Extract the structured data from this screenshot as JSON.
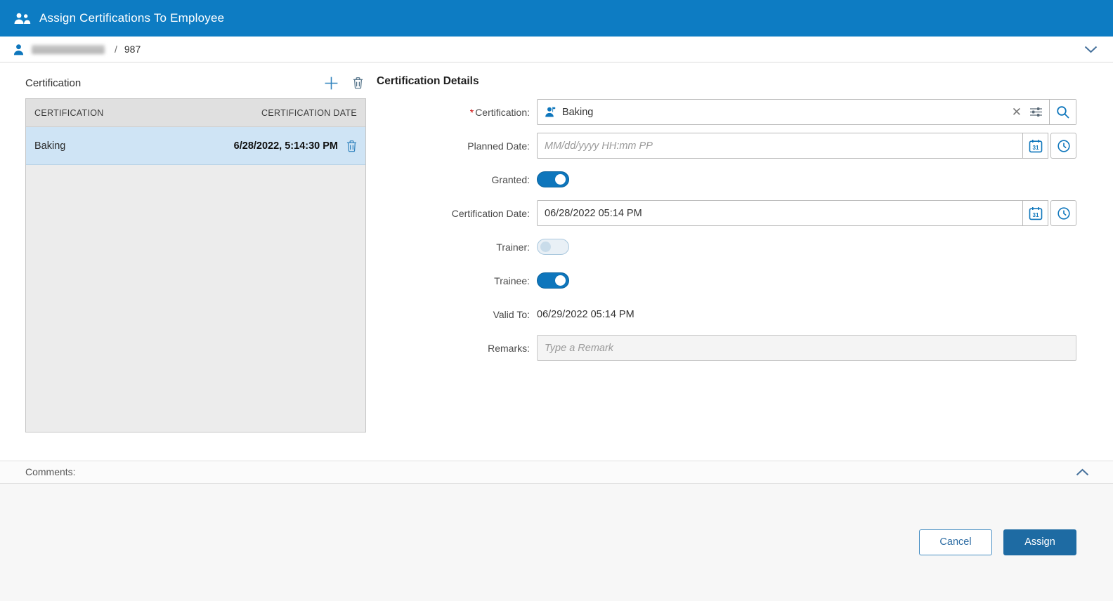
{
  "header": {
    "title": "Assign Certifications To Employee"
  },
  "employee_bar": {
    "separator": "/",
    "employee_id": "987"
  },
  "left_panel": {
    "title": "Certification",
    "table": {
      "columns": [
        "CERTIFICATION",
        "CERTIFICATION DATE"
      ],
      "rows": [
        {
          "certification": "Baking",
          "certification_date": "6/28/2022, 5:14:30 PM"
        }
      ]
    }
  },
  "details": {
    "title": "Certification Details",
    "certification": {
      "required_mark": "*",
      "label": "Certification:",
      "value": "Baking"
    },
    "planned_date": {
      "label": "Planned Date:",
      "placeholder": "MM/dd/yyyy HH:mm PP",
      "value": ""
    },
    "granted": {
      "label": "Granted:",
      "state": "on"
    },
    "certification_date": {
      "label": "Certification Date:",
      "value": "06/28/2022 05:14 PM"
    },
    "trainer": {
      "label": "Trainer:",
      "state": "off"
    },
    "trainee": {
      "label": "Trainee:",
      "state": "on"
    },
    "valid_to": {
      "label": "Valid To:",
      "value": "06/29/2022 05:14 PM"
    },
    "remarks": {
      "label": "Remarks:",
      "placeholder": "Type a Remark",
      "value": ""
    }
  },
  "comments": {
    "label": "Comments:"
  },
  "footer": {
    "cancel_label": "Cancel",
    "assign_label": "Assign"
  },
  "colors": {
    "header_blue": "#0d7cc3",
    "accent_blue": "#0e76bc",
    "assign_button_blue": "#1e6ba3",
    "selected_row_blue": "#cfe4f5",
    "table_header_gray": "#e0e0e0"
  }
}
